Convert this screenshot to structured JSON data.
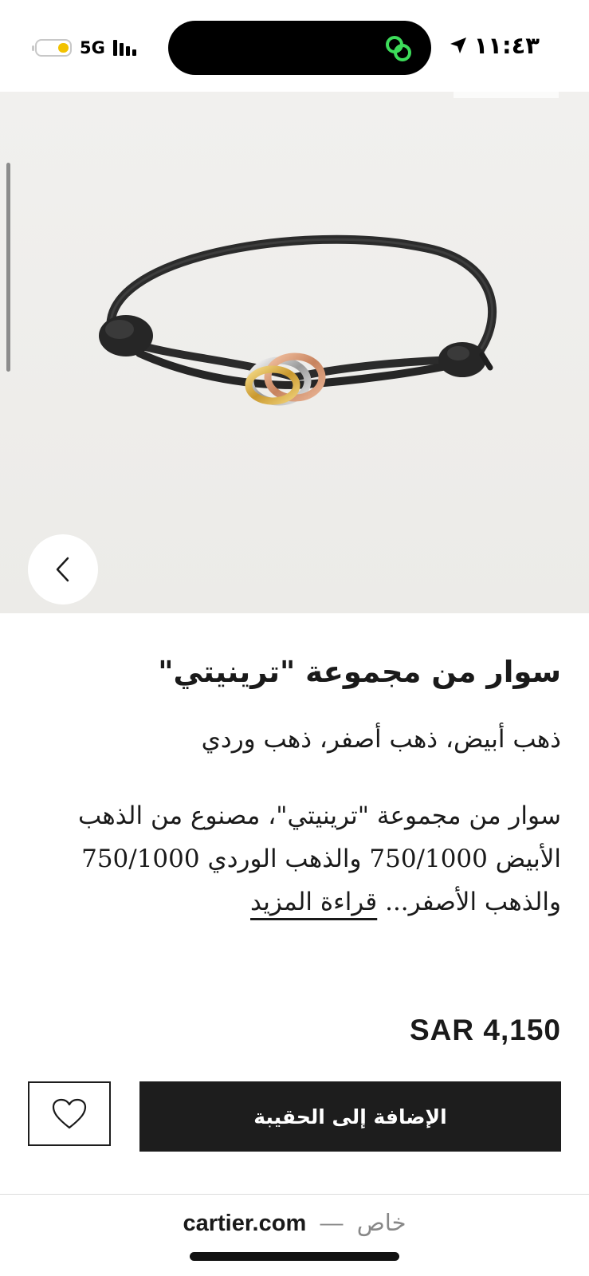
{
  "status_bar": {
    "time": "١١:٤٣",
    "network": "5G",
    "icons": [
      "location-arrow-icon",
      "link-icon",
      "signal-icon",
      "battery-icon"
    ]
  },
  "hero": {
    "image": "trinity-bracelet-black-cord",
    "prev_icon": "chevron-left-icon"
  },
  "product": {
    "title": "سوار من مجموعة \"ترينيتي\"",
    "materials": "ذهب أبيض، ذهب أصفر، ذهب وردي",
    "description": "سوار من مجموعة \"ترينيتي\"، مصنوع من الذهب الأبيض 750/1000 والذهب الوردي 750/1000 والذهب الأصفر...",
    "read_more": "قراءة المزيد",
    "price": "SAR 4,150",
    "add_to_bag": "الإضافة إلى الحقيبة",
    "wishlist_icon": "heart-icon"
  },
  "browser": {
    "domain": "cartier.com",
    "separator": "—",
    "mode": "خاص"
  },
  "colors": {
    "button_dark": "#1d1d1d",
    "hero_bg": "#eeede9",
    "battery_yellow": "#f2c200",
    "link_green": "#3ddc5a"
  }
}
